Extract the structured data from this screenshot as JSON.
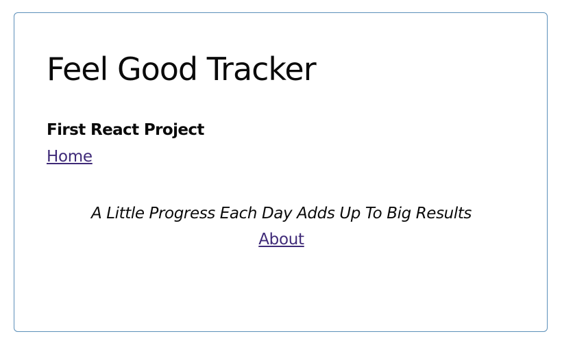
{
  "header": {
    "title": "Feel Good Tracker",
    "subtitle": "First React Project"
  },
  "nav": {
    "home_label": "Home",
    "about_label": "About"
  },
  "main": {
    "quote": "A Little Progress Each Day Adds Up To Big Results"
  },
  "colors": {
    "link": "#3f2a78",
    "card_border": "#5b8fb9",
    "text": "#0a0a0a"
  }
}
